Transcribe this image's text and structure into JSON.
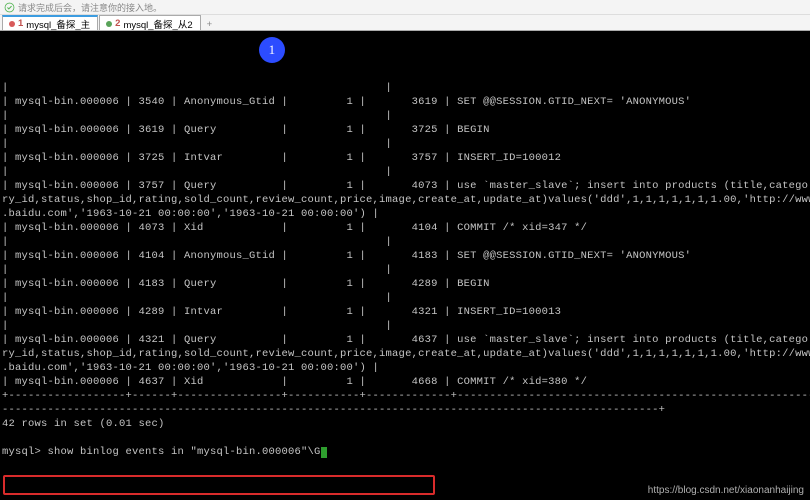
{
  "titlebar": {
    "text": "请求完成后会，请注意你的接入地。"
  },
  "tabs": [
    {
      "idx": "1",
      "label": "mysql_备探_主"
    },
    {
      "idx": "2",
      "label": "mysql_备探_从2"
    }
  ],
  "badge": "1",
  "rows": [
    {
      "log": "mysql-bin.000006",
      "pos": "3540",
      "event": "Anonymous_Gtid",
      "sid": "1",
      "end": "3619",
      "info": "SET @@SESSION.GTID_NEXT= 'ANONYMOUS'"
    },
    {
      "log": "mysql-bin.000006",
      "pos": "3619",
      "event": "Query",
      "sid": "1",
      "end": "3725",
      "info": "BEGIN"
    },
    {
      "log": "mysql-bin.000006",
      "pos": "3725",
      "event": "Intvar",
      "sid": "1",
      "end": "3757",
      "info": "INSERT_ID=100012"
    },
    {
      "log": "mysql-bin.000006",
      "pos": "3757",
      "event": "Query",
      "sid": "1",
      "end": "4073",
      "info": "use `master_slave`; insert into products (title,catego",
      "wrap": [
        "ry_id,status,shop_id,rating,sold_count,review_count,price,image,create_at,update_at)values('ddd',1,1,1,1,1,1,1.00,'http://www",
        ".baidu.com','1963-10-21 00:00:00','1963-10-21 00:00:00')"
      ]
    },
    {
      "log": "mysql-bin.000006",
      "pos": "4073",
      "event": "Xid",
      "sid": "1",
      "end": "4104",
      "info": "COMMIT /* xid=347 */"
    },
    {
      "log": "mysql-bin.000006",
      "pos": "4104",
      "event": "Anonymous_Gtid",
      "sid": "1",
      "end": "4183",
      "info": "SET @@SESSION.GTID_NEXT= 'ANONYMOUS'"
    },
    {
      "log": "mysql-bin.000006",
      "pos": "4183",
      "event": "Query",
      "sid": "1",
      "end": "4289",
      "info": "BEGIN"
    },
    {
      "log": "mysql-bin.000006",
      "pos": "4289",
      "event": "Intvar",
      "sid": "1",
      "end": "4321",
      "info": "INSERT_ID=100013"
    },
    {
      "log": "mysql-bin.000006",
      "pos": "4321",
      "event": "Query",
      "sid": "1",
      "end": "4637",
      "info": "use `master_slave`; insert into products (title,catego",
      "wrap": [
        "ry_id,status,shop_id,rating,sold_count,review_count,price,image,create_at,update_at)values('ddd',1,1,1,1,1,1,1.00,'http://www",
        ".baidu.com','1963-10-21 00:00:00','1963-10-21 00:00:00')"
      ]
    },
    {
      "log": "mysql-bin.000006",
      "pos": "4637",
      "event": "Xid",
      "sid": "1",
      "end": "4668",
      "info": "COMMIT /* xid=380 */"
    }
  ],
  "summary": "42 rows in set (0.01 sec)",
  "prompt": "mysql> ",
  "command": "show binlog events in \"mysql-bin.000006\"\\G",
  "watermark": "https://blog.csdn.net/xiaonanhaijing"
}
